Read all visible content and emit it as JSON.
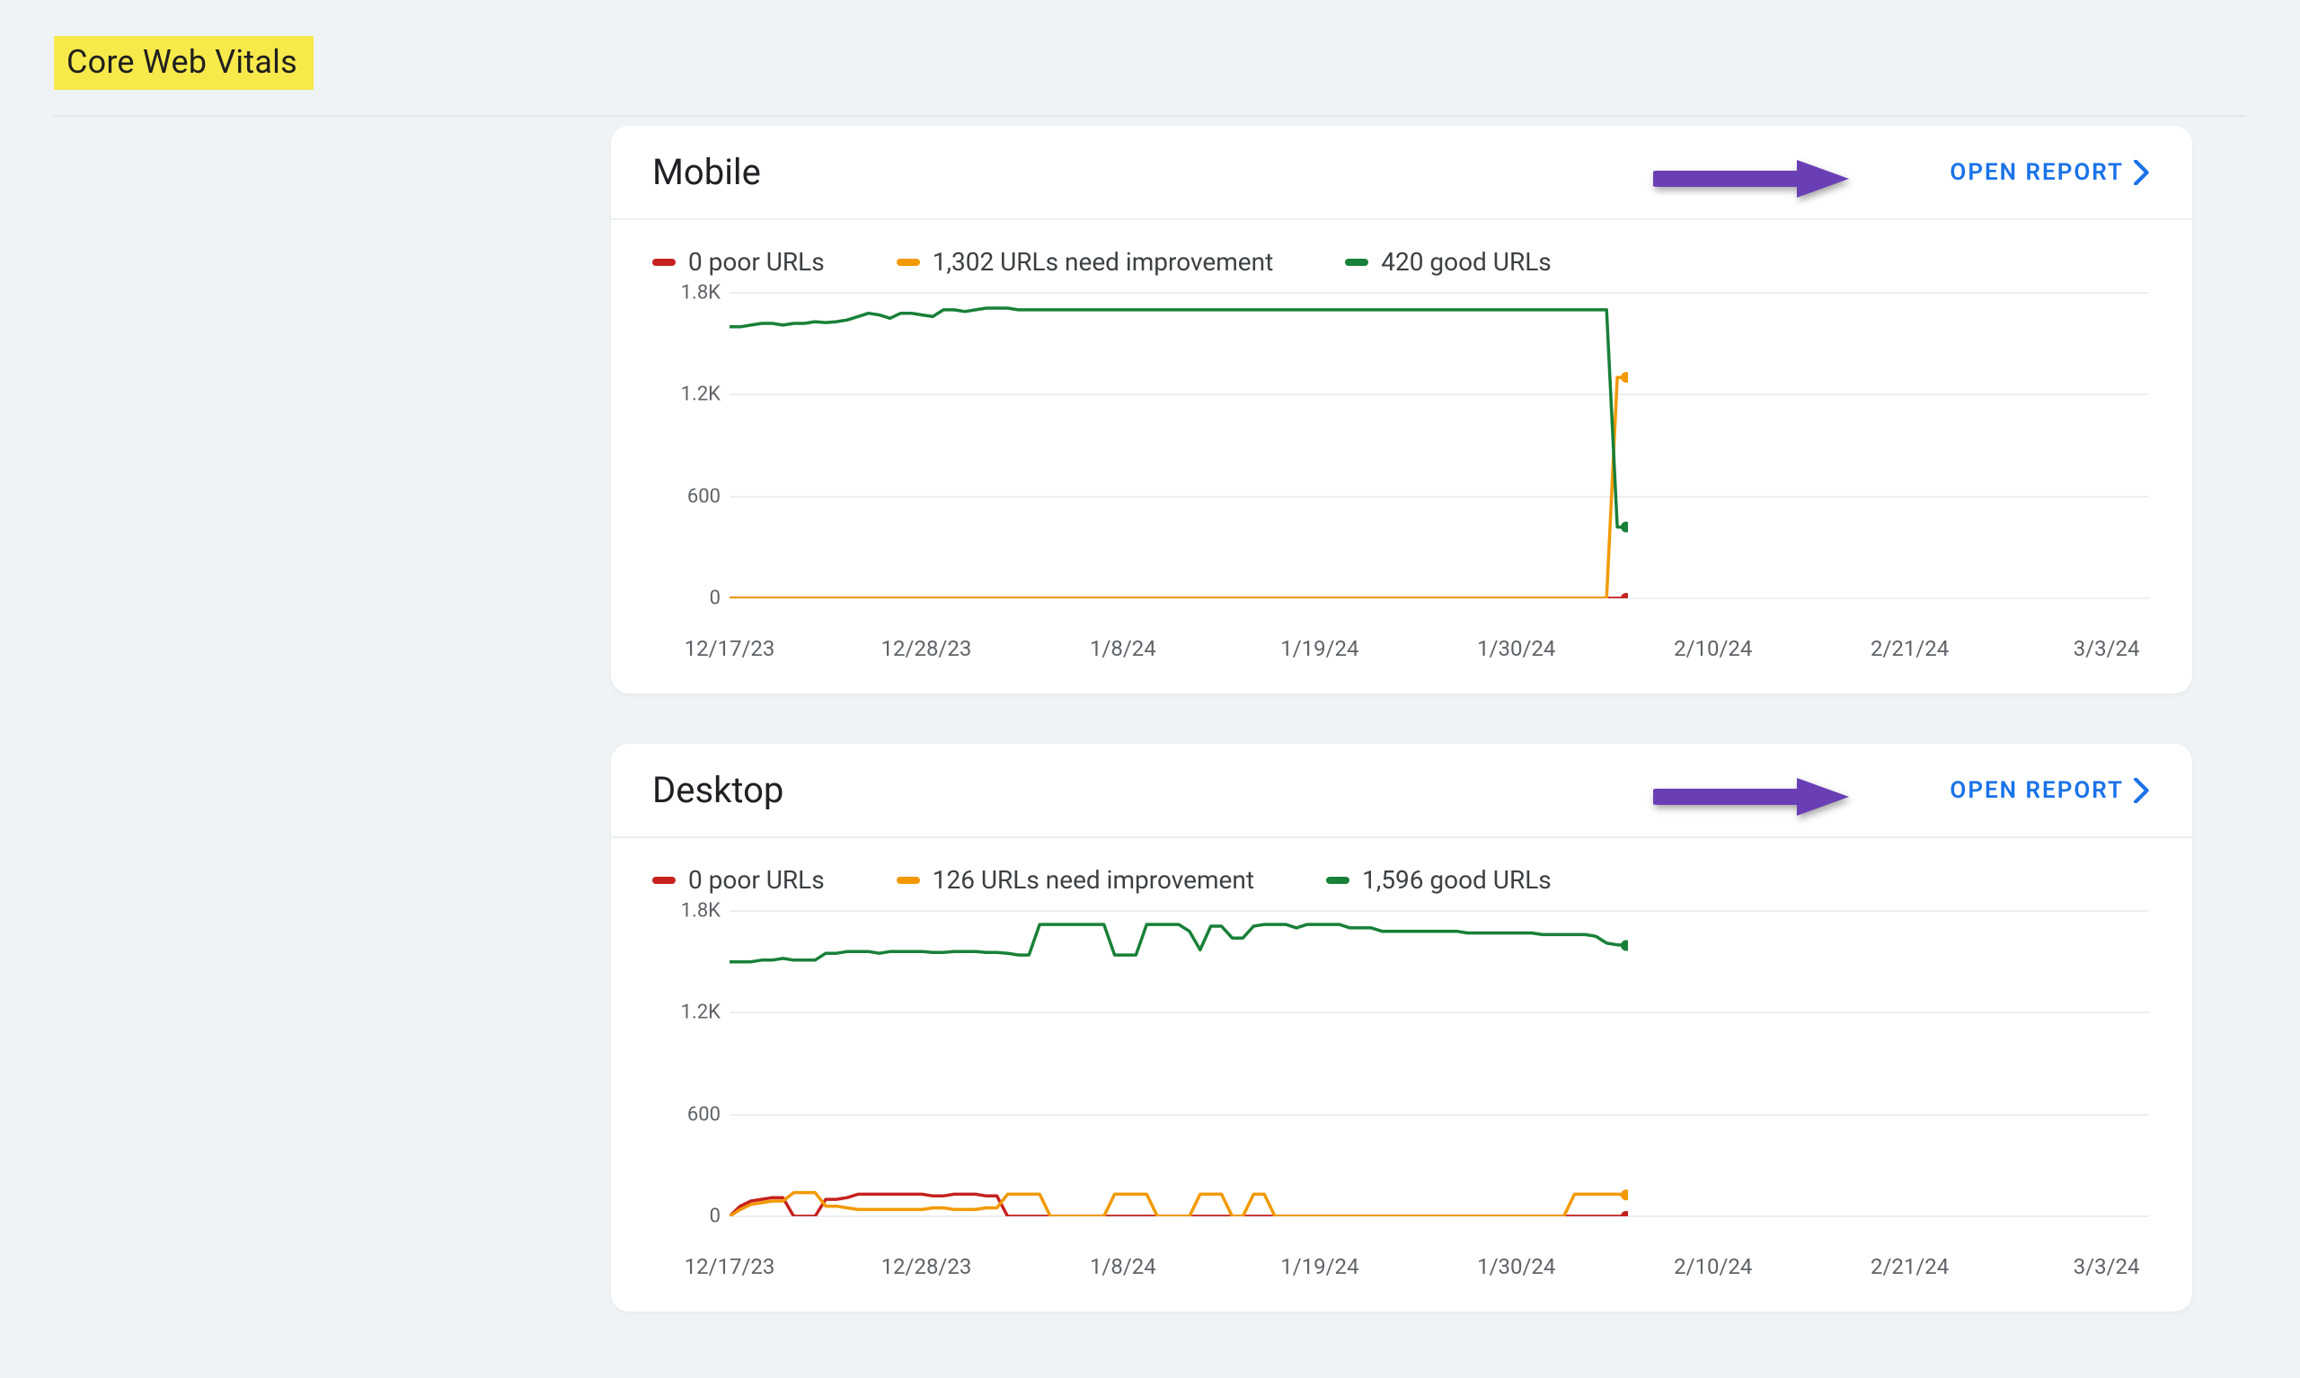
{
  "page_title": "Core Web Vitals",
  "open_report_label": "OPEN REPORT",
  "colors": {
    "poor": "#c5221f",
    "need": "#f29900",
    "good": "#188038",
    "link": "#1a73e8",
    "highlight": "#f7e94a",
    "arrow": "#6a3fb5"
  },
  "cards": [
    {
      "id": "mobile",
      "title": "Mobile",
      "legend": {
        "poor": "0 poor URLs",
        "need": "1,302 URLs need improvement",
        "good": "420 good URLs"
      }
    },
    {
      "id": "desktop",
      "title": "Desktop",
      "legend": {
        "poor": "0 poor URLs",
        "need": "126 URLs need improvement",
        "good": "1,596 good URLs"
      }
    }
  ],
  "chart_data": [
    {
      "id": "mobile",
      "type": "line",
      "xlabel": "",
      "ylabel": "",
      "title": "Mobile",
      "ylim": [
        0,
        1800
      ],
      "yticks": [
        0,
        600,
        1200,
        1800
      ],
      "ytick_labels": [
        "0",
        "600",
        "1.2K",
        "1.8K"
      ],
      "x_categories": [
        "12/17/23",
        "12/28/23",
        "1/8/24",
        "1/19/24",
        "1/30/24",
        "2/10/24",
        "2/21/24",
        "3/3/24"
      ],
      "n_points": 85,
      "series": [
        {
          "name": "poor URLs",
          "color": "#c5221f",
          "values": [
            0,
            0,
            0,
            0,
            0,
            0,
            0,
            0,
            0,
            0,
            0,
            0,
            0,
            0,
            0,
            0,
            0,
            0,
            0,
            0,
            0,
            0,
            0,
            0,
            0,
            0,
            0,
            0,
            0,
            0,
            0,
            0,
            0,
            0,
            0,
            0,
            0,
            0,
            0,
            0,
            0,
            0,
            0,
            0,
            0,
            0,
            0,
            0,
            0,
            0,
            0,
            0,
            0,
            0,
            0,
            0,
            0,
            0,
            0,
            0,
            0,
            0,
            0,
            0,
            0,
            0,
            0,
            0,
            0,
            0,
            0,
            0,
            0,
            0,
            0,
            0,
            0,
            0,
            0,
            0,
            0,
            0,
            0,
            0,
            0
          ],
          "end_dot": true
        },
        {
          "name": "URLs need improvement",
          "color": "#f29900",
          "values": [
            0,
            0,
            0,
            0,
            0,
            0,
            0,
            0,
            0,
            0,
            0,
            0,
            0,
            0,
            0,
            0,
            0,
            0,
            0,
            0,
            0,
            0,
            0,
            0,
            0,
            0,
            0,
            0,
            0,
            0,
            0,
            0,
            0,
            0,
            0,
            0,
            0,
            0,
            0,
            0,
            0,
            0,
            0,
            0,
            0,
            0,
            0,
            0,
            0,
            0,
            0,
            0,
            0,
            0,
            0,
            0,
            0,
            0,
            0,
            0,
            0,
            0,
            0,
            0,
            0,
            0,
            0,
            0,
            0,
            0,
            0,
            0,
            0,
            0,
            0,
            0,
            0,
            0,
            0,
            0,
            0,
            0,
            0,
            1302,
            1302
          ],
          "end_dot": true
        },
        {
          "name": "good URLs",
          "color": "#188038",
          "values": [
            1600,
            1600,
            1610,
            1620,
            1620,
            1610,
            1620,
            1620,
            1630,
            1625,
            1630,
            1640,
            1660,
            1680,
            1670,
            1650,
            1680,
            1680,
            1670,
            1660,
            1700,
            1700,
            1690,
            1700,
            1710,
            1710,
            1710,
            1700,
            1700,
            1700,
            1700,
            1700,
            1700,
            1700,
            1700,
            1700,
            1700,
            1700,
            1700,
            1700,
            1700,
            1700,
            1700,
            1700,
            1700,
            1700,
            1700,
            1700,
            1700,
            1700,
            1700,
            1700,
            1700,
            1700,
            1700,
            1700,
            1700,
            1700,
            1700,
            1700,
            1700,
            1700,
            1700,
            1700,
            1700,
            1700,
            1700,
            1700,
            1700,
            1700,
            1700,
            1700,
            1700,
            1700,
            1700,
            1700,
            1700,
            1700,
            1700,
            1700,
            1700,
            1700,
            1700,
            420,
            420
          ],
          "end_dot": true
        }
      ]
    },
    {
      "id": "desktop",
      "type": "line",
      "xlabel": "",
      "ylabel": "",
      "title": "Desktop",
      "ylim": [
        0,
        1800
      ],
      "yticks": [
        0,
        600,
        1200,
        1800
      ],
      "ytick_labels": [
        "0",
        "600",
        "1.2K",
        "1.8K"
      ],
      "x_categories": [
        "12/17/23",
        "12/28/23",
        "1/8/24",
        "1/19/24",
        "1/30/24",
        "2/10/24",
        "2/21/24",
        "3/3/24"
      ],
      "n_points": 85,
      "series": [
        {
          "name": "poor URLs",
          "color": "#c5221f",
          "values": [
            0,
            60,
            90,
            100,
            110,
            110,
            0,
            0,
            0,
            100,
            100,
            110,
            130,
            130,
            130,
            130,
            130,
            130,
            130,
            120,
            120,
            130,
            130,
            130,
            120,
            120,
            0,
            0,
            0,
            0,
            0,
            0,
            0,
            0,
            0,
            0,
            0,
            0,
            0,
            0,
            0,
            0,
            0,
            0,
            0,
            0,
            0,
            0,
            0,
            0,
            0,
            0,
            0,
            0,
            0,
            0,
            0,
            0,
            0,
            0,
            0,
            0,
            0,
            0,
            0,
            0,
            0,
            0,
            0,
            0,
            0,
            0,
            0,
            0,
            0,
            0,
            0,
            0,
            0,
            0,
            0,
            0,
            0,
            0,
            0
          ],
          "end_dot": true
        },
        {
          "name": "URLs need improvement",
          "color": "#f29900",
          "values": [
            0,
            40,
            70,
            80,
            90,
            90,
            140,
            140,
            140,
            60,
            60,
            50,
            40,
            40,
            40,
            40,
            40,
            40,
            40,
            50,
            50,
            40,
            40,
            40,
            50,
            50,
            130,
            130,
            130,
            130,
            0,
            0,
            0,
            0,
            0,
            0,
            130,
            130,
            130,
            130,
            0,
            0,
            0,
            0,
            130,
            130,
            130,
            0,
            0,
            130,
            130,
            0,
            0,
            0,
            0,
            0,
            0,
            0,
            0,
            0,
            0,
            0,
            0,
            0,
            0,
            0,
            0,
            0,
            0,
            0,
            0,
            0,
            0,
            0,
            0,
            0,
            0,
            0,
            0,
            130,
            130,
            130,
            130,
            130,
            126
          ],
          "end_dot": true
        },
        {
          "name": "good URLs",
          "color": "#188038",
          "values": [
            1500,
            1500,
            1500,
            1510,
            1510,
            1520,
            1510,
            1510,
            1510,
            1550,
            1550,
            1560,
            1560,
            1560,
            1550,
            1560,
            1560,
            1560,
            1560,
            1555,
            1555,
            1560,
            1560,
            1560,
            1555,
            1555,
            1550,
            1540,
            1540,
            1720,
            1720,
            1720,
            1720,
            1720,
            1720,
            1720,
            1540,
            1540,
            1540,
            1720,
            1720,
            1720,
            1720,
            1680,
            1570,
            1710,
            1710,
            1640,
            1640,
            1710,
            1720,
            1720,
            1720,
            1700,
            1720,
            1720,
            1720,
            1720,
            1700,
            1700,
            1700,
            1680,
            1680,
            1680,
            1680,
            1680,
            1680,
            1680,
            1680,
            1670,
            1670,
            1670,
            1670,
            1670,
            1670,
            1670,
            1660,
            1660,
            1660,
            1660,
            1660,
            1650,
            1610,
            1600,
            1596
          ],
          "end_dot": true
        }
      ]
    }
  ]
}
